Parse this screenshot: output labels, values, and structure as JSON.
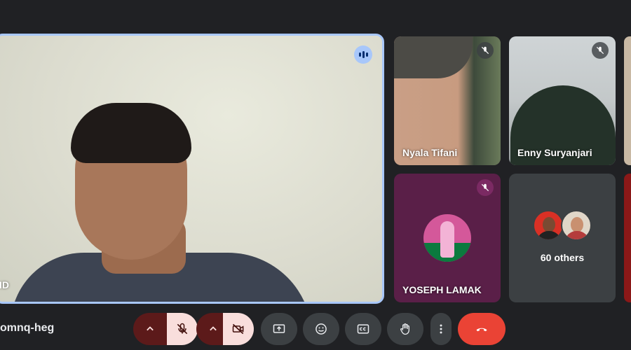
{
  "main_speaker": {
    "name_suffix": "ID",
    "speaking": true
  },
  "participants": [
    {
      "name": "Nyala Tifani",
      "muted": true
    },
    {
      "name": "Enny Suryanjari",
      "muted": true
    },
    {
      "name": "YOSEPH LAMAK",
      "muted": true
    }
  ],
  "others": {
    "label": "60 others"
  },
  "meeting": {
    "code_fragment": "omnq-heg"
  },
  "controls": {
    "mic": {
      "state": "off",
      "icon": "mic-off-icon"
    },
    "camera": {
      "state": "off",
      "icon": "camera-off-icon"
    },
    "present": {
      "icon": "present-screen-icon"
    },
    "reactions": {
      "icon": "emoji-icon"
    },
    "captions": {
      "icon": "captions-icon"
    },
    "raise_hand": {
      "icon": "hand-icon"
    },
    "more": {
      "icon": "more-vert-icon"
    },
    "hangup": {
      "icon": "call-end-icon"
    }
  },
  "colors": {
    "background": "#202124",
    "speaking_border": "#a8c7fa",
    "muted_control_bg": "#f9dedc",
    "muted_control_arrow_bg": "#5c1a1a",
    "hangup": "#ea4335"
  }
}
